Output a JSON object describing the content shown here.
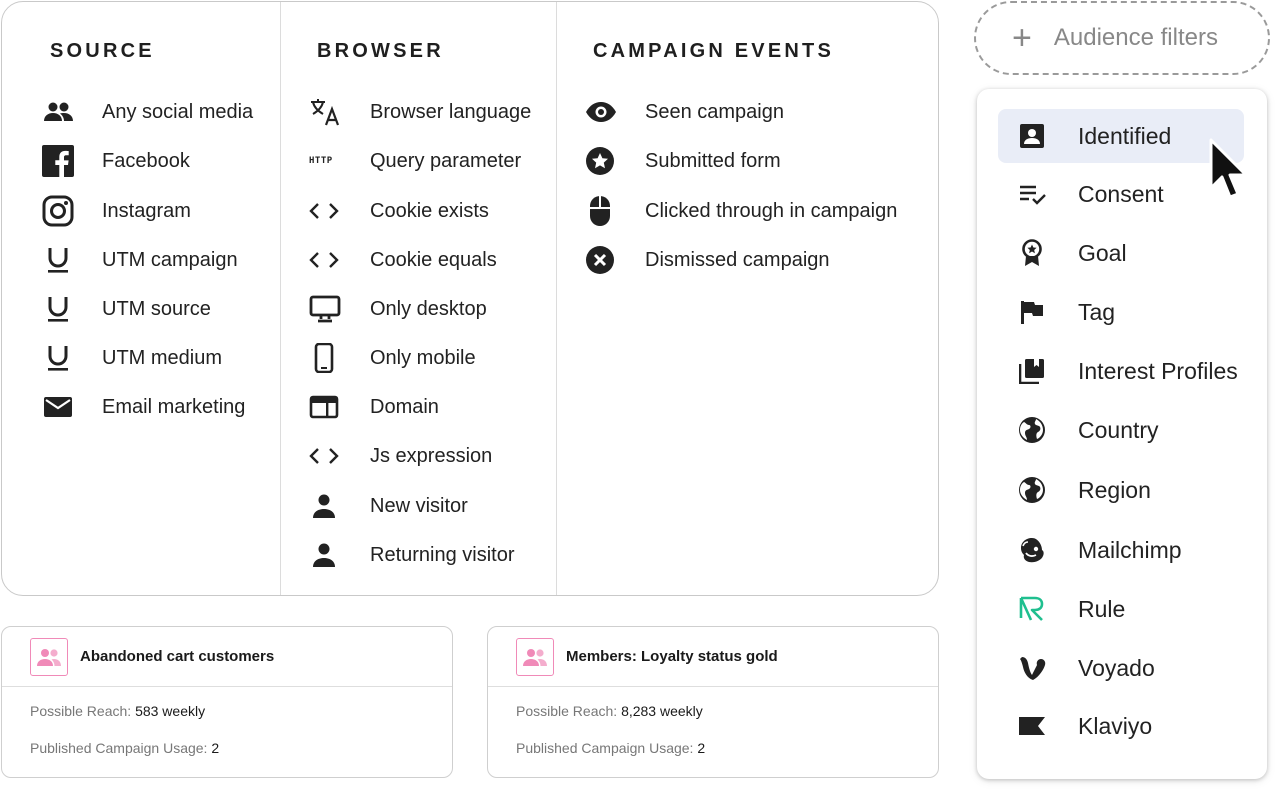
{
  "source": {
    "title": "SOURCE",
    "items": [
      {
        "label": "Any social media",
        "icon": "group-icon"
      },
      {
        "label": "Facebook",
        "icon": "facebook-icon"
      },
      {
        "label": "Instagram",
        "icon": "instagram-icon"
      },
      {
        "label": "UTM campaign",
        "icon": "underline-icon"
      },
      {
        "label": "UTM source",
        "icon": "underline-icon"
      },
      {
        "label": "UTM medium",
        "icon": "underline-icon"
      },
      {
        "label": "Email marketing",
        "icon": "mail-icon"
      }
    ]
  },
  "browser": {
    "title": "BROWSER",
    "http_text": "HTTP",
    "items": [
      {
        "label": "Browser language",
        "icon": "translate-icon"
      },
      {
        "label": "Query parameter",
        "icon": "http-icon"
      },
      {
        "label": "Cookie exists",
        "icon": "code-icon"
      },
      {
        "label": "Cookie equals",
        "icon": "code-icon"
      },
      {
        "label": "Only desktop",
        "icon": "desktop-icon"
      },
      {
        "label": "Only mobile",
        "icon": "mobile-icon"
      },
      {
        "label": "Domain",
        "icon": "browser-window-icon"
      },
      {
        "label": "Js expression",
        "icon": "code-icon"
      },
      {
        "label": "New visitor",
        "icon": "person-icon"
      },
      {
        "label": "Returning visitor",
        "icon": "person-icon"
      }
    ]
  },
  "campaign_events": {
    "title": "CAMPAIGN EVENTS",
    "items": [
      {
        "label": "Seen campaign",
        "icon": "eye-icon"
      },
      {
        "label": "Submitted form",
        "icon": "star-circle-icon"
      },
      {
        "label": "Clicked through in campaign",
        "icon": "mouse-icon"
      },
      {
        "label": "Dismissed campaign",
        "icon": "cancel-circle-icon"
      }
    ]
  },
  "segments": [
    {
      "title": "Abandoned cart customers",
      "reach_label": "Possible Reach:",
      "reach_value": "583 weekly",
      "usage_label": "Published Campaign Usage:",
      "usage_value": "2"
    },
    {
      "title": "Members: Loyalty status gold",
      "reach_label": "Possible Reach:",
      "reach_value": "8,283 weekly",
      "usage_label": "Published Campaign Usage:",
      "usage_value": "2"
    }
  ],
  "audience_filters": {
    "button_label": "Audience filters",
    "plus": "+",
    "selected": "Identified",
    "items": [
      {
        "label": "Identified",
        "icon": "identity-card-icon"
      },
      {
        "label": "Consent",
        "icon": "checklist-icon"
      },
      {
        "label": "Goal",
        "icon": "award-icon"
      },
      {
        "label": "Tag",
        "icon": "flag-icon"
      },
      {
        "label": "Interest Profiles",
        "icon": "library-icon"
      },
      {
        "label": "Country",
        "icon": "globe-icon"
      },
      {
        "label": "Region",
        "icon": "globe-icon"
      },
      {
        "label": "Mailchimp",
        "icon": "mailchimp-icon"
      },
      {
        "label": "Rule",
        "icon": "rule-icon"
      },
      {
        "label": "Voyado",
        "icon": "voyado-icon"
      },
      {
        "label": "Klaviyo",
        "icon": "klaviyo-icon"
      }
    ]
  },
  "colors": {
    "segment_icon": "#f08ab8",
    "rule_icon": "#1fbf8f",
    "selected_bg": "#e9edf7"
  }
}
